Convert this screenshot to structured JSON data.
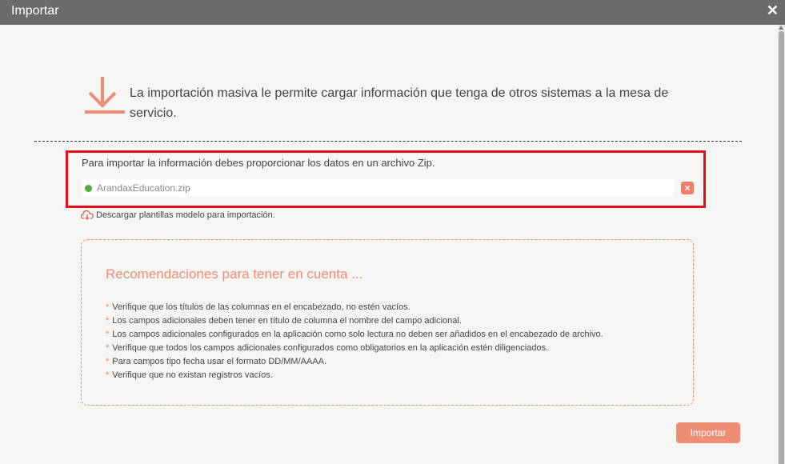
{
  "dialog": {
    "title": "Importar",
    "close_symbol": "✕"
  },
  "intro": {
    "icon": "download-arrow-icon",
    "text": "La importación masiva le permite cargar información que tenga de otros sistemas a la mesa de servicio."
  },
  "upload": {
    "label": "Para importar la información debes proporcionar los datos en un archivo Zip.",
    "file_name": "ArandaxEducation.zip",
    "status_color": "#4caf3e",
    "remove_symbol": "×"
  },
  "download_link": {
    "icon": "cloud-download-icon",
    "label": "Descargar plantillas modelo para importación."
  },
  "recommendations": {
    "title": "Recomendaciones para tener en cuenta ...",
    "bullet": "*",
    "items": [
      "Verifique que los títulos de las columnas en el encabezado, no estén vacíos.",
      "Los campos adicionales deben tener en título de columna el nombre del campo adicional.",
      "Los campos adicionales configurados en la aplicación como solo lectura no deben ser añadidos en el encabezado de archivo.",
      "Verifique que todos los campos adicionales configurados como obligatorios en la aplicación estén diligenciados.",
      "Para campos tipo fecha usar el formato DD/MM/AAAA.",
      "Verifique que no existan registros vacíos."
    ]
  },
  "footer": {
    "import_label": "Importar"
  },
  "colors": {
    "accent": "#ef8c74",
    "titlebar": "#6b6b6b",
    "highlight_border": "#e0101a"
  }
}
